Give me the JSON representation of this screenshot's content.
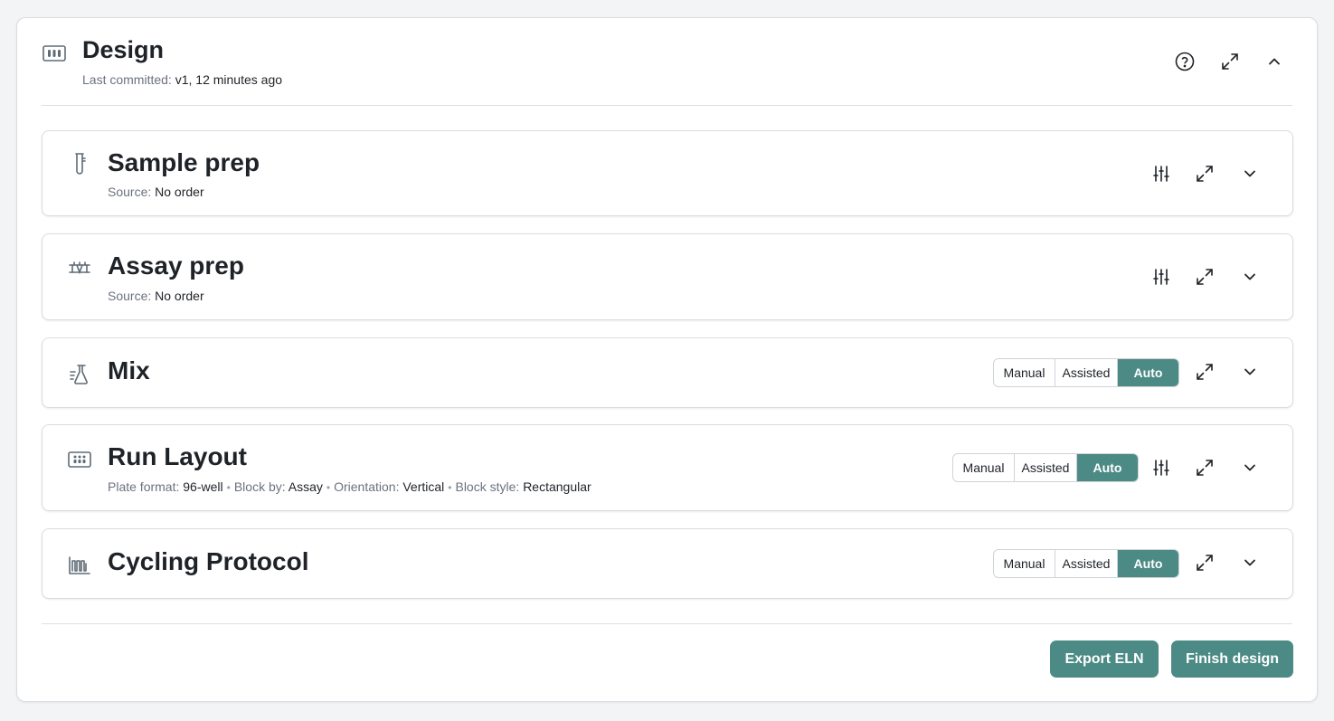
{
  "design": {
    "title": "Design",
    "committed_label": "Last committed:",
    "committed_value": "v1, 12 minutes ago"
  },
  "sections": [
    {
      "title": "Sample prep",
      "source_label": "Source:",
      "source_value": "No order",
      "icon": "test-tube-icon"
    },
    {
      "title": "Assay prep",
      "source_label": "Source:",
      "source_value": "No order",
      "icon": "bench-icon"
    },
    {
      "title": "Mix",
      "icon": "flask-icon",
      "modes": [
        "Manual",
        "Assisted",
        "Auto"
      ],
      "active_mode": "Auto"
    },
    {
      "title": "Run Layout",
      "icon": "plate-icon",
      "modes": [
        "Manual",
        "Assisted",
        "Auto"
      ],
      "active_mode": "Auto",
      "meta": [
        {
          "label": "Plate format:",
          "value": "96-well"
        },
        {
          "label": "Block by:",
          "value": "Assay"
        },
        {
          "label": "Orientation:",
          "value": "Vertical"
        },
        {
          "label": "Block style:",
          "value": "Rectangular"
        }
      ]
    },
    {
      "title": "Cycling Protocol",
      "icon": "cycling-chart-icon",
      "modes": [
        "Manual",
        "Assisted",
        "Auto"
      ],
      "active_mode": "Auto"
    }
  ],
  "footer": {
    "export_label": "Export ELN",
    "finish_label": "Finish design"
  },
  "colors": {
    "accent": "#4b8a85",
    "background": "#f3f4f6",
    "muted_text": "#6b7280"
  }
}
